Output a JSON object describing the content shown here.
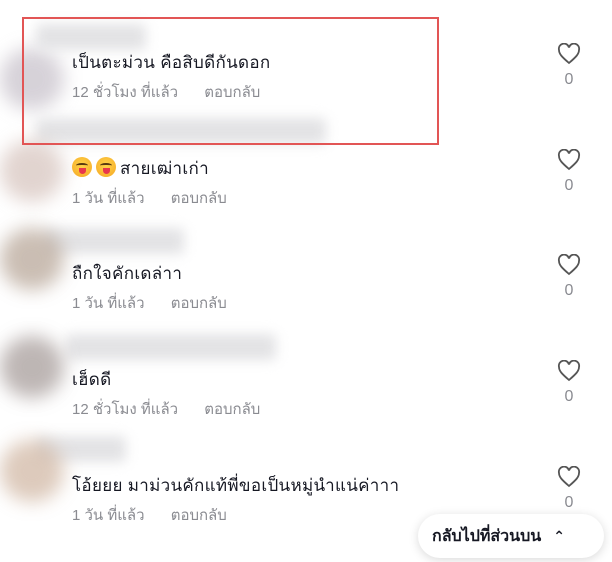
{
  "comments": [
    {
      "text": "เป็นตะม่วน คือสิบดีกันดอก",
      "time": "12 ชั่วโมง ที่แล้ว",
      "reply": "ตอบกลับ",
      "likes": "0"
    },
    {
      "text": "สายเฒ่าเก่า",
      "emojis": [
        "face-with-tongue-emoji",
        "face-with-tongue-emoji"
      ],
      "time": "1 วัน ที่แล้ว",
      "reply": "ตอบกลับ",
      "likes": "0"
    },
    {
      "text": "ถืกใจคักเดล่าา",
      "time": "1 วัน ที่แล้ว",
      "reply": "ตอบกลับ",
      "likes": "0"
    },
    {
      "text": "เฮ็ดดี",
      "time": "12 ชั่วโมง ที่แล้ว",
      "reply": "ตอบกลับ",
      "likes": "0"
    },
    {
      "text": "โอ้ยยย มาม่วนคักแท้พี่ขอเป็นหมู่นำแน่ค่าาา",
      "time": "1 วัน ที่แล้ว",
      "reply": "ตอบกลับ",
      "likes": "0"
    }
  ],
  "back_to_top": {
    "label": "กลับไปที่ส่วนบน",
    "icon": "chevron-double-up-icon"
  },
  "colors": {
    "highlight": "#e25555",
    "meta": "#8a8b91"
  }
}
